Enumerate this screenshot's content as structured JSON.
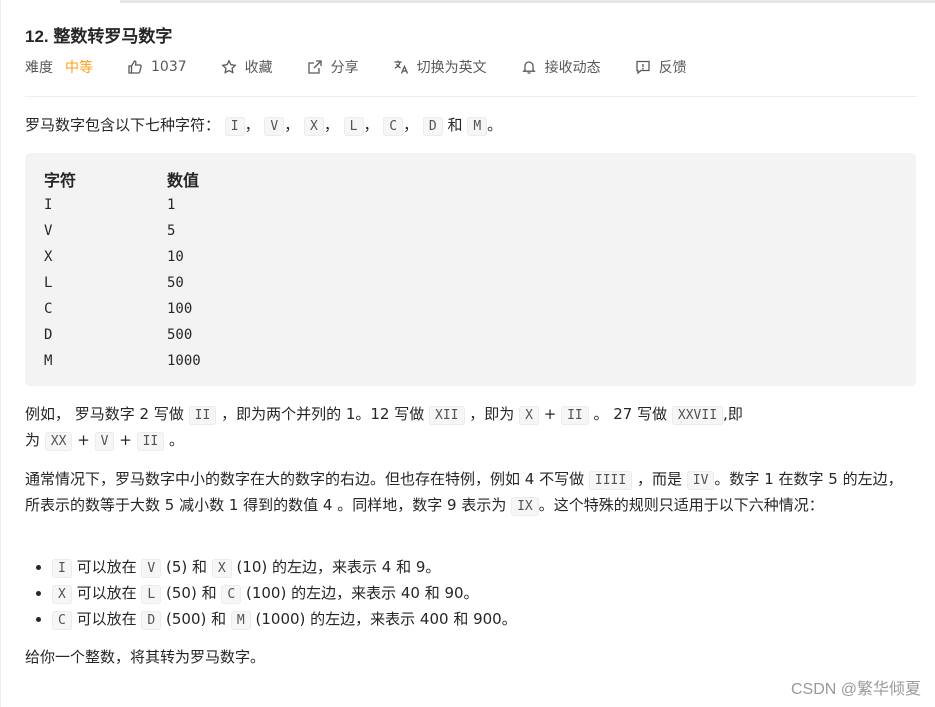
{
  "problem": {
    "title": "12. 整数转罗马数字",
    "difficulty_label": "难度",
    "difficulty": "中等",
    "likes": "1037",
    "favorite_label": "收藏",
    "share_label": "分享",
    "switch_lang_label": "切换为英文",
    "subscribe_label": "接收动态",
    "feedback_label": "反馈"
  },
  "colors": {
    "difficulty": "#ffa116",
    "code_bg": "#f3f3f4"
  },
  "intro": {
    "prefix": "罗马数字包含以下七种字符：",
    "symbols": [
      "I",
      "V",
      "X",
      "L",
      "C",
      "D",
      "M"
    ],
    "sep": "，",
    "and": "和",
    "end": "。"
  },
  "table": {
    "headers": [
      "字符",
      "数值"
    ],
    "rows": [
      [
        "I",
        "1"
      ],
      [
        "V",
        "5"
      ],
      [
        "X",
        "10"
      ],
      [
        "L",
        "50"
      ],
      [
        "C",
        "100"
      ],
      [
        "D",
        "500"
      ],
      [
        "M",
        "1000"
      ]
    ]
  },
  "example": {
    "t1": "例如， 罗马数字 2 写做",
    "c1": "II",
    "t2": "，即为两个并列的 1。12 写做",
    "c2": "XII",
    "t3": "，即为",
    "c3": "X",
    "plus": "+",
    "c4": "II",
    "t4": "。 27 写做",
    "c5": "XXVII",
    "t5": ",即",
    "t6": "为",
    "c6": "XX",
    "c7": "V",
    "c8": "II",
    "t7": "。"
  },
  "special": {
    "t1": "通常情况下，罗马数字中小的数字在大的数字的右边。但也存在特例，例如 4 不写做",
    "c1": "IIII",
    "t2": "，而是",
    "c2": "IV",
    "t3": "。数字 1 在数字 5 的左边，所表示的数等于大数 5 减小数 1 得到的数值 4 。同样地，数字 9 表示为",
    "c3": "IX",
    "t4": "。这个特殊的规则只适用于以下六种情况："
  },
  "rules": [
    {
      "a": "I",
      "m1": "可以放在",
      "b": "V",
      "bv": "(5) 和",
      "c": "X",
      "cv": "(10) 的左边，来表示 4 和 9。"
    },
    {
      "a": "X",
      "m1": "可以放在",
      "b": "L",
      "bv": "(50) 和",
      "c": "C",
      "cv": "(100) 的左边，来表示 40 和 90。"
    },
    {
      "a": "C",
      "m1": "可以放在",
      "b": "D",
      "bv": "(500) 和",
      "c": "M",
      "cv": "(1000) 的左边，来表示 400 和 900。"
    }
  ],
  "task": "给你一个整数，将其转为罗马数字。",
  "watermark": "CSDN @繁华倾夏"
}
